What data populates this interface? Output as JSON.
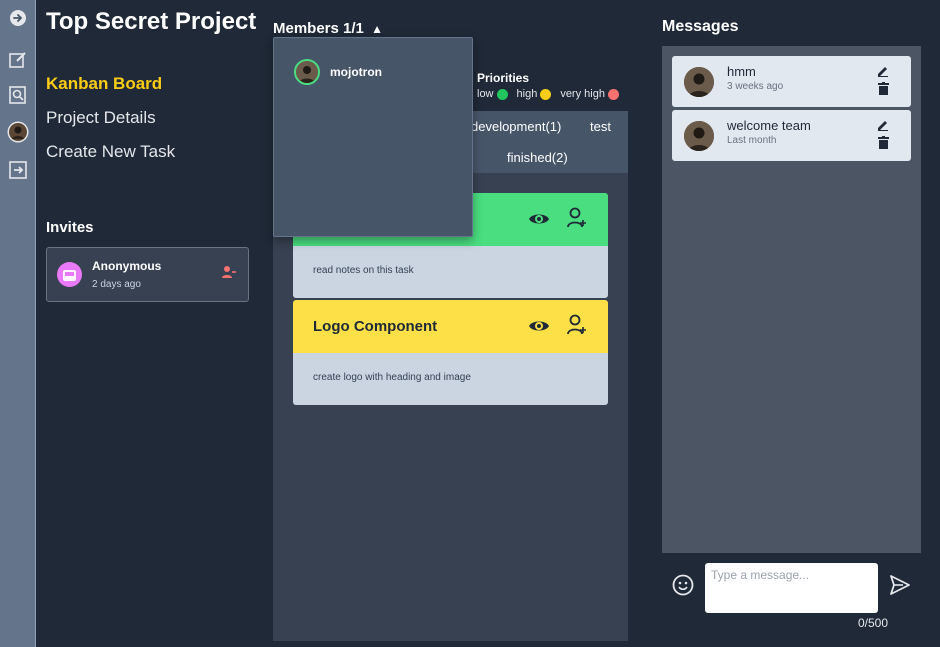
{
  "colors": {
    "accent_yellow": "#facc15",
    "task_green": "#4ade80",
    "task_yellow": "#fde047",
    "prio_low": "#22c55e",
    "prio_high": "#facc15",
    "prio_very_high": "#f87171"
  },
  "rail": {
    "icons": [
      "arrow-right-circle-icon",
      "edit-note-icon",
      "search-doc-icon",
      "user-avatar-icon",
      "logout-icon"
    ]
  },
  "project": {
    "title": "Top Secret Project"
  },
  "nav": {
    "kanban": "Kanban Board",
    "details": "Project Details",
    "create": "Create New Task"
  },
  "invites": {
    "heading": "Invites",
    "items": [
      {
        "name": "Anonymous",
        "time": "2 days ago"
      }
    ]
  },
  "members": {
    "heading": "Members 1/1",
    "caret": "▲",
    "list": [
      {
        "name": "mojotron"
      }
    ]
  },
  "priorities": {
    "heading": "Priorities",
    "low": "low",
    "high": "high",
    "very_high": "very high"
  },
  "statuses": {
    "development": "development(1)",
    "test": "test",
    "finished": "finished(2)"
  },
  "tasks": [
    {
      "title": "",
      "desc": "read notes on this task",
      "color": "#4ade80"
    },
    {
      "title": "Logo Component",
      "desc": "create logo with heading and image",
      "color": "#fde047"
    }
  ],
  "messages": {
    "heading": "Messages",
    "items": [
      {
        "text": "hmm",
        "time": "3 weeks ago"
      },
      {
        "text": "welcome team",
        "time": "Last month"
      }
    ],
    "input_placeholder": "Type a message...",
    "char_count": "0/500"
  }
}
